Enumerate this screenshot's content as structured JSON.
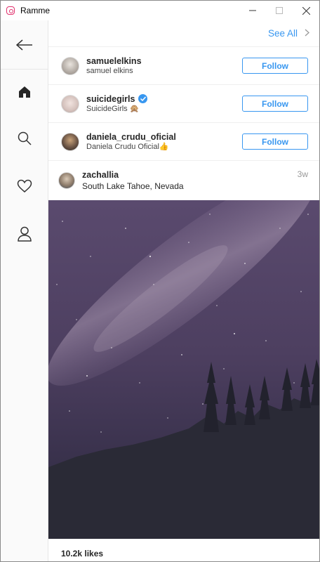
{
  "window": {
    "title": "Ramme"
  },
  "header": {
    "see_all": "See All"
  },
  "suggestions": [
    {
      "username": "samuelelkins",
      "name": "samuel elkins",
      "button": "Follow",
      "verified": false,
      "avatar_color": "#b9b3ad"
    },
    {
      "username": "suicidegirls",
      "name": "SuicideGirls 🙊",
      "button": "Follow",
      "verified": true,
      "avatar_color": "#d8c9c6"
    },
    {
      "username": "daniela_crudu_oficial",
      "name": "Daniela Crudu Oficial👍",
      "button": "Follow",
      "verified": false,
      "avatar_color": "#6b5445"
    }
  ],
  "post": {
    "username": "zachallia",
    "location": "South Lake Tahoe, Nevada",
    "time": "3w",
    "likes": "10.2k likes"
  },
  "colors": {
    "accent": "#3897f0",
    "brand": "#e1306c"
  }
}
